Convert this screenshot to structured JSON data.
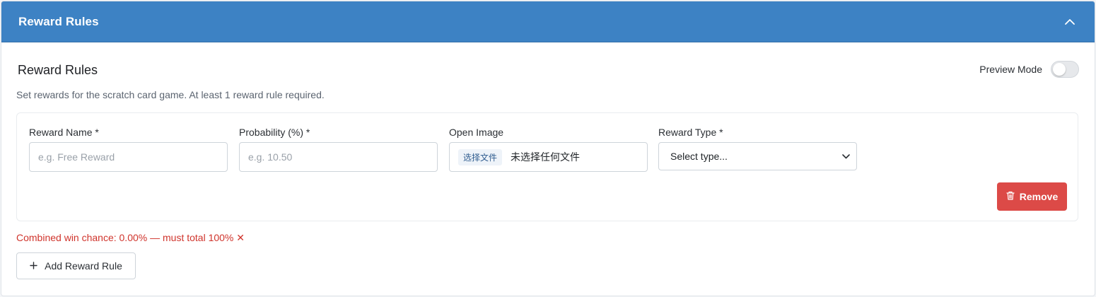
{
  "header": {
    "title": "Reward Rules",
    "collapse_icon": "chevron-up-icon",
    "bg_color": "#3d82c4"
  },
  "section": {
    "title": "Reward Rules",
    "preview_label": "Preview Mode",
    "preview_enabled": false,
    "description": "Set rewards for the scratch card game. At least 1 reward rule required."
  },
  "rule": {
    "reward_name_label": "Reward Name *",
    "reward_name_value": "",
    "reward_name_placeholder": "e.g. Free Reward",
    "probability_label": "Probability (%) *",
    "probability_value": "",
    "probability_placeholder": "e.g. 10.50",
    "image_label": "Open Image",
    "file_button": "选择文件",
    "file_status": "未选择任何文件",
    "type_label": "Reward Type *",
    "type_selected": "Select type...",
    "remove_label": "Remove",
    "remove_color": "#dc4a47"
  },
  "footer": {
    "warning": "Combined win chance: 0.00% — must total 100% ✕",
    "warning_color": "#d0342c",
    "add_label": "Add Reward Rule"
  }
}
